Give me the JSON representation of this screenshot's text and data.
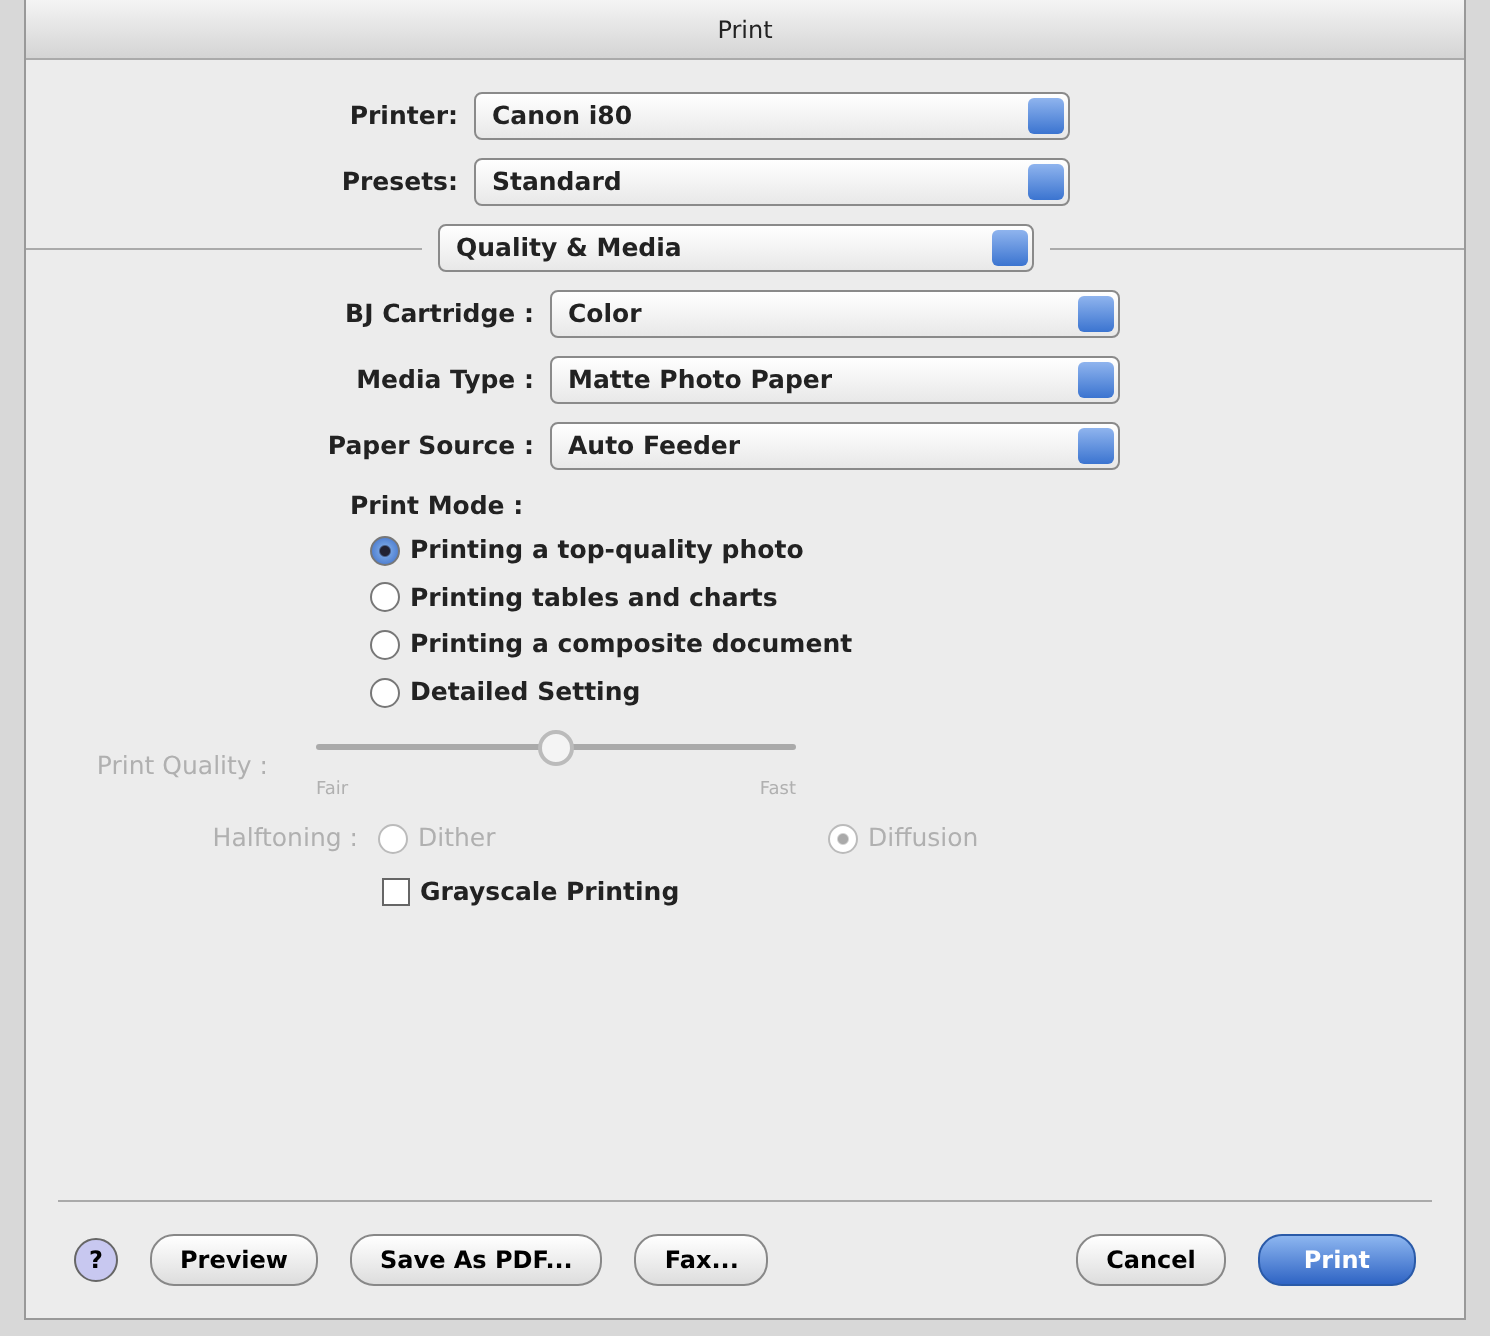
{
  "window": {
    "title": "Print"
  },
  "top_popups": [
    {
      "label": "Printer:",
      "value": "Canon i80"
    },
    {
      "label": "Presets:",
      "value": "Standard"
    }
  ],
  "section_popup": {
    "value": "Quality & Media"
  },
  "settings_popups": [
    {
      "label": "BJ Cartridge :",
      "value": "Color"
    },
    {
      "label": "Media Type :",
      "value": "Matte Photo Paper"
    },
    {
      "label": "Paper Source :",
      "value": "Auto Feeder"
    }
  ],
  "print_mode": {
    "label": "Print Mode :",
    "options": [
      {
        "label": "Printing a top-quality photo",
        "selected": true
      },
      {
        "label": "Printing tables and charts",
        "selected": false
      },
      {
        "label": "Printing a composite document",
        "selected": false
      },
      {
        "label": "Detailed Setting",
        "selected": false
      }
    ]
  },
  "print_quality": {
    "label": "Print Quality :",
    "disabled": true,
    "level": 0.5,
    "min_label": "Fair",
    "max_label": "Fast"
  },
  "halftoning": {
    "label": "Halftoning :",
    "disabled": true,
    "options": [
      {
        "label": "Dither",
        "selected": false
      },
      {
        "label": "Diffusion",
        "selected": true
      }
    ]
  },
  "grayscale": {
    "label": "Grayscale Printing",
    "checked": false
  },
  "buttons": [
    {
      "kind": "help",
      "label": "?"
    },
    {
      "kind": "normal",
      "label": "Preview"
    },
    {
      "kind": "normal",
      "label": "Save As PDF..."
    },
    {
      "kind": "normal",
      "label": "Fax..."
    },
    {
      "kind": "spacer"
    },
    {
      "kind": "normal",
      "label": "Cancel"
    },
    {
      "kind": "default",
      "label": "Print"
    }
  ]
}
